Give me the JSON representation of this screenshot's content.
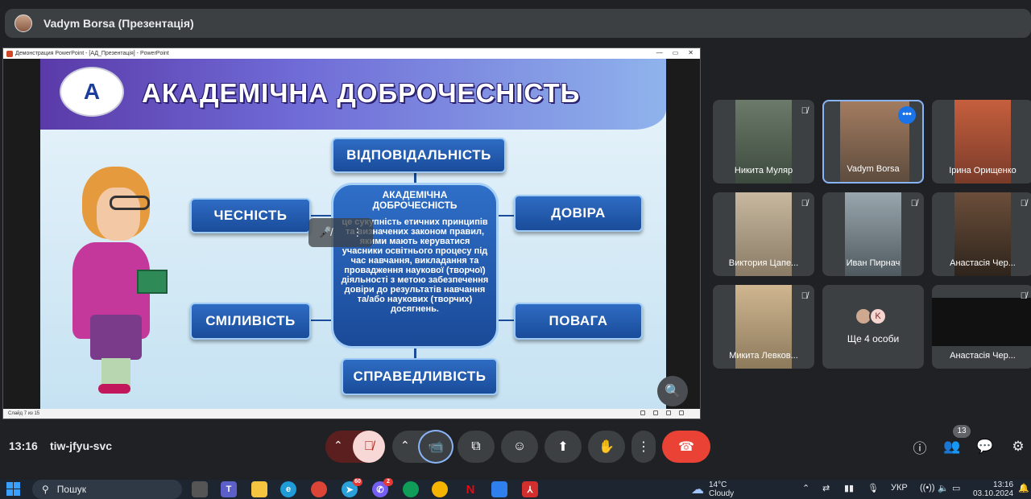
{
  "presenter": {
    "name": "Vadym Borsa (Презентація)"
  },
  "ppt": {
    "window_title": "Демонстрация PowerPoint - [АД_Презентація] - PowerPoint",
    "status": "Слайд 7 из 15",
    "win_min": "—",
    "win_max": "▭",
    "win_close": "✕"
  },
  "slide": {
    "logo": "A",
    "title": "АКАДЕМІЧНА ДОБРОЧЕСНІСТЬ",
    "center_title": "АКАДЕМІЧНА ДОБРОЧЕСНІСТЬ",
    "center_text": "це сукупність етичних принципів та визначених законом правил, якими мають керуватися учасники освітнього процесу під час навчання, викладання та провадження наукової (творчої) діяльності з метою забезпечення довіри до результатів навчання та/або наукових (творчих) досягнень.",
    "boxes": {
      "top": "ВІДПОВІДАЛЬНІСТЬ",
      "left_top": "ЧЕСНІСТЬ",
      "right_top": "ДОВІРА",
      "left_bottom": "СМІЛИВІСТЬ",
      "right_bottom": "ПОВАГА",
      "bottom": "СПРАВЕДЛИВІСТЬ"
    }
  },
  "zoom_icon": "magnifier-plus",
  "participants": [
    {
      "name": "Никита Муляр",
      "muted": true
    },
    {
      "name": "Vadym Borsa",
      "muted": false,
      "more": "•••"
    },
    {
      "name": "Ірина Орищенко",
      "muted": false
    },
    {
      "name": "Виктория Цапе...",
      "muted": true
    },
    {
      "name": "Иван Пирнач",
      "muted": true
    },
    {
      "name": "Анастасія Чер...",
      "muted": true
    },
    {
      "name": "Микита Левков...",
      "muted": true
    },
    {
      "name": "Анастасія Чер...",
      "muted": true
    }
  ],
  "more_people": {
    "label": "Ще 4 особи",
    "initial": "K"
  },
  "meeting": {
    "time": "13:16",
    "code": "tiw-jfyu-svc",
    "people_count": "13"
  },
  "controls": [
    {
      "name": "mic-toggle",
      "icon": "mic-off-icon"
    },
    {
      "name": "camera-toggle",
      "icon": "camera-icon"
    },
    {
      "name": "captions",
      "icon": "captions-icon"
    },
    {
      "name": "emoji",
      "icon": "emoji-icon"
    },
    {
      "name": "present",
      "icon": "present-icon"
    },
    {
      "name": "raise-hand",
      "icon": "hand-icon"
    },
    {
      "name": "more-options",
      "icon": "more-icon"
    },
    {
      "name": "end-call",
      "icon": "phone-hangup-icon"
    }
  ],
  "taskbar": {
    "search_placeholder": "Пошук",
    "badges": {
      "telegram": "60",
      "viber": "2"
    },
    "weather_temp": "14°C",
    "weather_desc": "Cloudy",
    "lang": "УКР",
    "time": "13:16",
    "date": "03.10.2024"
  },
  "colors": {
    "end_call": "#ea4335",
    "active_border": "#8ab4f8",
    "mic_off_bg": "#f8d8d6"
  }
}
